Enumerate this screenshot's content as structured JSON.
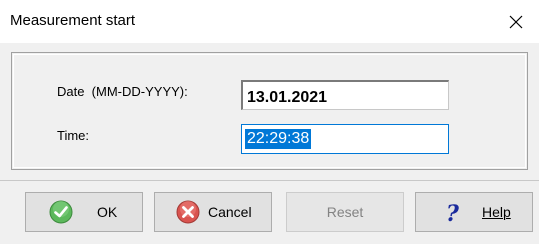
{
  "window": {
    "title": "Measurement start",
    "close_icon": "close-icon"
  },
  "form": {
    "date_label": "Date  (MM-DD-YYYY):",
    "date_value": "13.01.2021",
    "time_label": "Time:",
    "time_value": "22:29:38"
  },
  "buttons": {
    "ok": {
      "label": "OK",
      "icon": "check-circle-icon"
    },
    "cancel": {
      "label": "Cancel",
      "icon": "cancel-circle-icon"
    },
    "reset": {
      "label": "Reset",
      "enabled": false
    },
    "help": {
      "label": "Help",
      "icon": "question-mark-icon"
    }
  },
  "colors": {
    "selection": "#0078d7",
    "ok_icon": "#5cb85c",
    "cancel_icon": "#d9534f",
    "help_icon": "#1a2a9c"
  }
}
